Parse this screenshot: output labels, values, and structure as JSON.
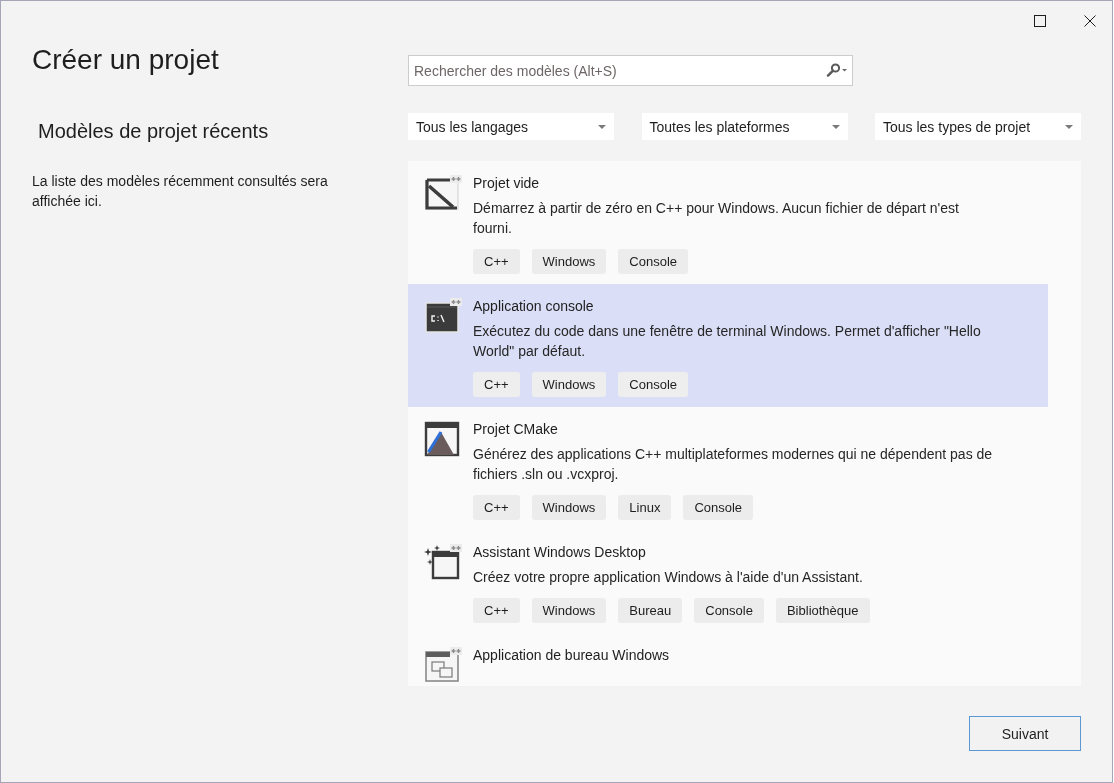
{
  "heading": "Créer un projet",
  "recent": {
    "title": "Modèles de projet récents",
    "message": "La liste des modèles récemment consultés sera affichée ici."
  },
  "search": {
    "placeholder": "Rechercher des modèles (Alt+S)"
  },
  "filters": [
    {
      "label": "Tous les langages"
    },
    {
      "label": "Toutes les plateformes"
    },
    {
      "label": "Tous les types de projet"
    }
  ],
  "templates": [
    {
      "kind": "empty",
      "title": "Projet vide",
      "description": "Démarrez à partir de zéro en C++ pour Windows. Aucun fichier de départ n'est fourni.",
      "tags": [
        "C++",
        "Windows",
        "Console"
      ],
      "selected": false
    },
    {
      "kind": "console",
      "title": "Application console",
      "description": "Exécutez du code dans une fenêtre de terminal Windows. Permet d'afficher \"Hello World\" par défaut.",
      "tags": [
        "C++",
        "Windows",
        "Console"
      ],
      "selected": true
    },
    {
      "kind": "cmake",
      "title": "Projet CMake",
      "description": "Générez des applications C++ multiplateformes modernes qui ne dépendent pas de fichiers .sln ou .vcxproj.",
      "tags": [
        "C++",
        "Windows",
        "Linux",
        "Console"
      ],
      "selected": false
    },
    {
      "kind": "wizard",
      "title": "Assistant Windows Desktop",
      "description": "Créez votre propre application Windows à l'aide d'un Assistant.",
      "tags": [
        "C++",
        "Windows",
        "Bureau",
        "Console",
        "Bibliothèque"
      ],
      "selected": false
    },
    {
      "kind": "desktop",
      "title": "Application de bureau Windows",
      "selected": false
    }
  ],
  "next_button": "Suivant"
}
